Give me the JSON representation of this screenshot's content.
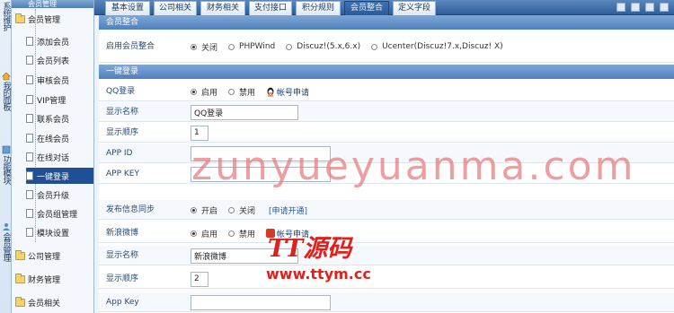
{
  "tree": {
    "header": "会员管理",
    "group": "会员管理",
    "items": [
      "添加会员",
      "会员列表",
      "审核会员",
      "VIP管理",
      "联系会员",
      "在线会员",
      "在线对话",
      "一键登录",
      "会员升级",
      "会员组管理",
      "模块设置"
    ],
    "selected": "一键登录",
    "folders": [
      "公司管理",
      "财务管理",
      "会员相关"
    ]
  },
  "vnav": [
    {
      "label": "系统维护",
      "icon": "system-icon"
    },
    {
      "label": "我的面板",
      "icon": "home-icon"
    },
    {
      "label": "功能模块",
      "icon": "module-icon"
    },
    {
      "label": "会员管理",
      "icon": "user-icon"
    }
  ],
  "tabs": [
    {
      "label": "基本设置"
    },
    {
      "label": "公司相关"
    },
    {
      "label": "财务相关"
    },
    {
      "label": "支付接口"
    },
    {
      "label": "积分规则"
    },
    {
      "label": "会员整合",
      "active": true
    },
    {
      "label": "定义字段"
    }
  ],
  "integration": {
    "heading": "会员整合",
    "row_label": "启用会员整合",
    "options": [
      "关闭",
      "PHPWind",
      "Discuz!(5.x,6.x)",
      "Ucenter(Discuz!7.x,Discuz! X)"
    ],
    "selected": "关闭"
  },
  "onekey": {
    "heading": "一键登录",
    "qq_login_label": "QQ登录",
    "qq_enable": "启用",
    "qq_disable": "禁用",
    "qq_apply": "帐号申请",
    "display_name_label": "显示名称",
    "display_name_value": "QQ登录",
    "display_order_label": "显示顺序",
    "display_order_value": "1",
    "app_id_label": "APP ID",
    "app_key_label": "APP KEY",
    "sync_label": "发布信息同步",
    "sync_on": "开启",
    "sync_off": "关闭",
    "sync_link": "[申请开通]",
    "weibo_label": "新浪微博",
    "weibo_enable": "启用",
    "weibo_disable": "禁用",
    "weibo_apply": "帐号申请",
    "display_name2_label": "显示名称",
    "display_name2_value": "新浪微博",
    "display_order2_label": "显示顺序",
    "display_order2_value": "2",
    "app_key2_label": "App Key"
  },
  "watermarks": {
    "domain": "zunyueyuanma.com",
    "brand": "TT源码",
    "brand_url": "www.ttym.cc"
  },
  "colors": {
    "tab_bar": "#2f5d99",
    "section_header": "#4f80bd",
    "selected_item": "#1f4f94",
    "watermark": "#e0211b"
  }
}
